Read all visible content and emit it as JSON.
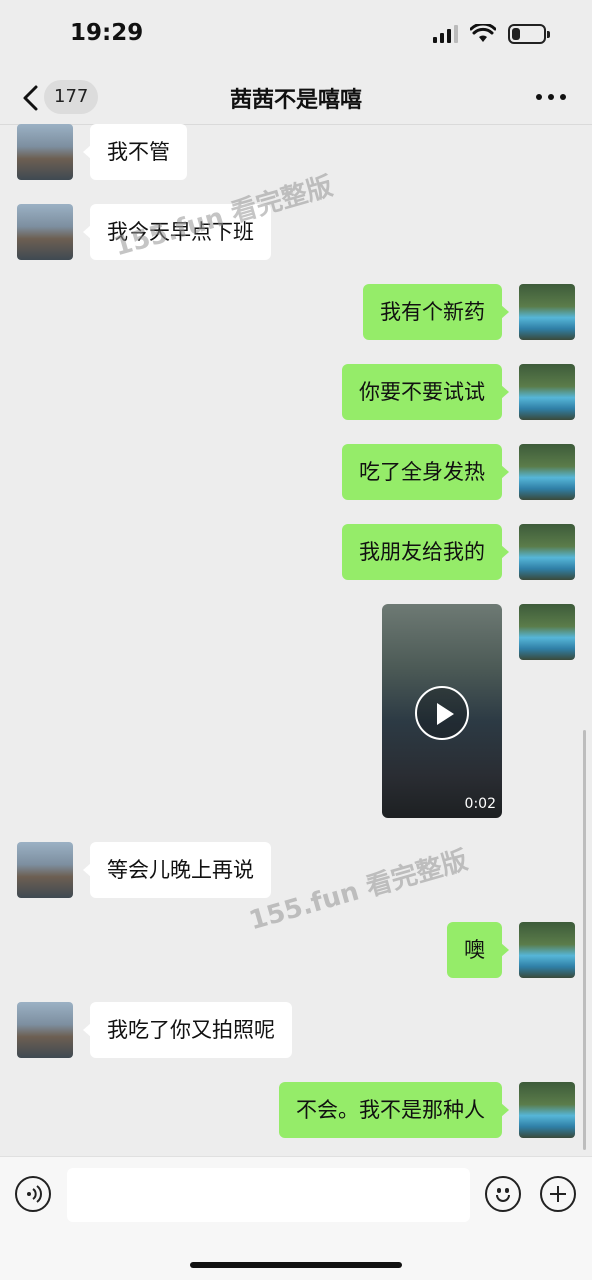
{
  "status_bar": {
    "time": "19:29",
    "signal_icon": "cellular-signal-icon",
    "wifi_icon": "wifi-icon",
    "battery_icon": "battery-icon",
    "battery_level": 0.25
  },
  "nav": {
    "back_icon": "chevron-left-icon",
    "unread_count": "177",
    "title": "茜茜不是嘻嘻",
    "more_icon": "ellipsis-icon"
  },
  "messages": [
    {
      "side": "in",
      "text": "我不管"
    },
    {
      "side": "in",
      "text": "我今天早点下班"
    },
    {
      "side": "out",
      "text": "我有个新药"
    },
    {
      "side": "out",
      "text": "你要不要试试"
    },
    {
      "side": "out",
      "text": "吃了全身发热"
    },
    {
      "side": "out",
      "text": "我朋友给我的"
    },
    {
      "side": "out",
      "type": "video",
      "duration": "0:02"
    },
    {
      "side": "in",
      "text": "等会儿晚上再说"
    },
    {
      "side": "out",
      "text": "噢"
    },
    {
      "side": "in",
      "text": "我吃了你又拍照呢"
    },
    {
      "side": "out",
      "text": "不会。我不是那种人"
    }
  ],
  "watermarks": [
    "155.fun 看完整版",
    "155.fun 看完整版"
  ],
  "input_bar": {
    "voice_icon": "voice-icon",
    "input_value": "",
    "emoji_icon": "emoji-icon",
    "plus_icon": "plus-icon"
  },
  "colors": {
    "background": "#ededed",
    "outgoing_bubble": "#95ec69",
    "incoming_bubble": "#ffffff"
  }
}
